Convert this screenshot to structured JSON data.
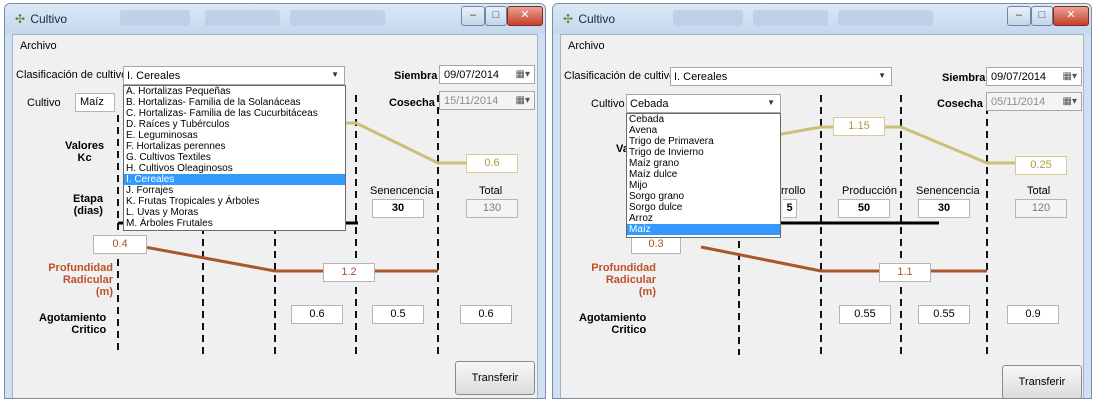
{
  "app_title": "Cultivo",
  "menu_file": "Archivo",
  "labels": {
    "classification": "Clasificación de cultivo",
    "crop": "Cultivo",
    "sowing": "Siembra",
    "harvest": "Cosecha",
    "kc_line1": "Valores",
    "kc_line2": "Kc",
    "stage_line1": "Etapa",
    "stage_line2": "(dias)",
    "root_line1": "Profundidad",
    "root_line2": "Radicular",
    "root_line3": "(m)",
    "depl_line1": "Agotamiento",
    "depl_line2": "Critico",
    "senescence": "Senencencia",
    "total": "Total",
    "production": "Producción",
    "development_partial": "rrollo"
  },
  "transfer_button": "Transferir Datos",
  "left": {
    "classification": "I. Cereales",
    "crop": "Maíz",
    "sowing": "09/07/2014",
    "harvest": "15/11/2014",
    "kc_end": "0.6",
    "senescence_days": "30",
    "total_days": "130",
    "root_start": "0.4",
    "root_max": "1.2",
    "depletion": [
      "0.6",
      "0.5",
      "0.6"
    ],
    "classification_options": [
      "A. Hortalizas Pequeñas",
      "B. Hortalizas- Familia de la Solanáceas",
      "C. Hortalizas- Familia de las Cucurbitáceas",
      "D. Raíces y Tubérculos",
      "E. Leguminosas",
      "F. Hortalizas perennes",
      "G. Cultivos Textiles",
      "H. Cultivos Oleaginosos",
      "I. Cereales",
      "J. Forrajes",
      "K. Frutas Tropicales y Árboles",
      "L. Uvas y Moras",
      "M. Árboles Frutales"
    ],
    "selected_option": "I. Cereales"
  },
  "right": {
    "classification": "I. Cereales",
    "crop": "Cebada",
    "sowing": "09/07/2014",
    "harvest": "05/11/2014",
    "kc_mid": "1.15",
    "kc_end": "0.25",
    "development_days_partial": "5",
    "production_days": "50",
    "senescence_days": "30",
    "total_days": "120",
    "root_start_partial": "0.3",
    "root_max": "1.1",
    "depletion": [
      "0.55",
      "0.55",
      "0.9"
    ],
    "crop_options": [
      "Cebada",
      "Avena",
      "Trigo de Primavera",
      "Trigo de Invierno",
      "Maíz grano",
      "Maíz dulce",
      "Mijo",
      "Sorgo grano",
      "Sorgo dulce",
      "Arroz",
      "Maíz"
    ],
    "selected_option": "Maíz"
  },
  "colors": {
    "kc_line": "#c9c07a",
    "root_line": "#a9562d",
    "selection": "#3399ff",
    "red_label": "#c0502a"
  }
}
